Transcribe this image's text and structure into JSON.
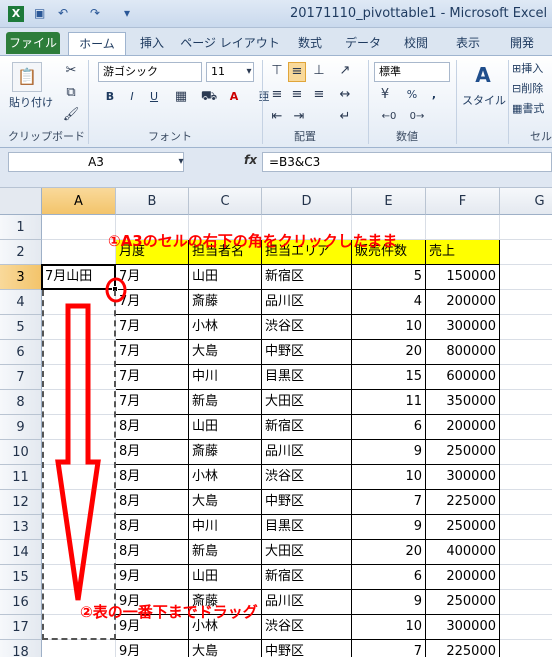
{
  "window": {
    "title": "20171110_pivottable1 - Microsoft Excel",
    "qat_icons": [
      "excel-logo-icon",
      "save-icon",
      "undo-icon",
      "redo-icon"
    ]
  },
  "tabs": [
    "ファイル",
    "ホーム",
    "挿入",
    "ページ レイアウト",
    "数式",
    "データ",
    "校閲",
    "表示",
    "開発"
  ],
  "ribbon": {
    "clipboard": {
      "paste_label": "貼り付け",
      "group_label": "クリップボード"
    },
    "font": {
      "font_name": "游ゴシック",
      "font_size": "11",
      "group_label": "フォント",
      "bold": "B",
      "italic": "I",
      "underline": "U",
      "grow": "A",
      "shrink": "A",
      "color_a": "A",
      "phonetic": "亜"
    },
    "alignment": {
      "group_label": "配置"
    },
    "number": {
      "format": "標準",
      "group_label": "数値",
      "percent": "%",
      "comma": ","
    },
    "styles": {
      "label": "スタイル"
    },
    "cells": {
      "insert": "挿入",
      "delete": "削除",
      "format": "書式",
      "group_label": "セル"
    }
  },
  "formula_bar": {
    "name_box": "A3",
    "fx": "fx",
    "formula": "=B3&C3"
  },
  "columns": [
    "A",
    "B",
    "C",
    "D",
    "E",
    "F",
    "G"
  ],
  "rows": [
    "1",
    "2",
    "3",
    "4",
    "5",
    "6",
    "7",
    "8",
    "9",
    "10",
    "11",
    "12",
    "13",
    "14",
    "15",
    "16",
    "17",
    "18"
  ],
  "active_cell_value": "7月山田",
  "table": {
    "headers": [
      "月度",
      "担当者名",
      "担当エリア",
      "販売件数",
      "売上"
    ],
    "rows": [
      [
        "7月",
        "山田",
        "新宿区",
        "5",
        "150000"
      ],
      [
        "7月",
        "斎藤",
        "品川区",
        "4",
        "200000"
      ],
      [
        "7月",
        "小林",
        "渋谷区",
        "10",
        "300000"
      ],
      [
        "7月",
        "大島",
        "中野区",
        "20",
        "800000"
      ],
      [
        "7月",
        "中川",
        "目黒区",
        "15",
        "600000"
      ],
      [
        "7月",
        "新島",
        "大田区",
        "11",
        "350000"
      ],
      [
        "8月",
        "山田",
        "新宿区",
        "6",
        "200000"
      ],
      [
        "8月",
        "斎藤",
        "品川区",
        "9",
        "250000"
      ],
      [
        "8月",
        "小林",
        "渋谷区",
        "10",
        "300000"
      ],
      [
        "8月",
        "大島",
        "中野区",
        "7",
        "225000"
      ],
      [
        "8月",
        "中川",
        "目黒区",
        "9",
        "250000"
      ],
      [
        "8月",
        "新島",
        "大田区",
        "20",
        "400000"
      ],
      [
        "9月",
        "山田",
        "新宿区",
        "6",
        "200000"
      ],
      [
        "9月",
        "斎藤",
        "品川区",
        "9",
        "250000"
      ],
      [
        "9月",
        "小林",
        "渋谷区",
        "10",
        "300000"
      ],
      [
        "9月",
        "大島",
        "中野区",
        "7",
        "225000"
      ]
    ]
  },
  "annotations": {
    "step1": "①A3のセルの右下の角をクリックしたまま",
    "step2": "②表の一番下までドラッグ",
    "color": "#ff0000"
  }
}
